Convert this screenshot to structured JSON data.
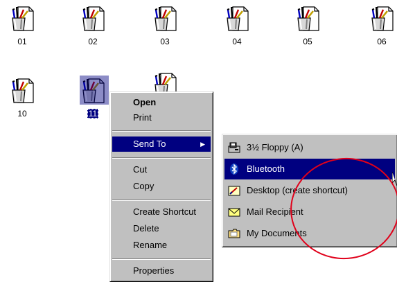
{
  "desktop": {
    "files": [
      {
        "label": "01"
      },
      {
        "label": "02"
      },
      {
        "label": "03"
      },
      {
        "label": "04"
      },
      {
        "label": "05"
      },
      {
        "label": "06"
      },
      {
        "label": "10"
      },
      {
        "label": "11",
        "selected": true
      },
      {
        "label": ""
      }
    ]
  },
  "context_menu": {
    "open": "Open",
    "print": "Print",
    "send_to": "Send To",
    "cut": "Cut",
    "copy": "Copy",
    "create_shortcut": "Create Shortcut",
    "delete": "Delete",
    "rename": "Rename",
    "properties": "Properties"
  },
  "send_to_menu": {
    "items": [
      {
        "label": "3½ Floppy (A)",
        "icon": "floppy-drive-icon"
      },
      {
        "label": "Bluetooth",
        "icon": "bluetooth-icon",
        "highlighted": true
      },
      {
        "label": "Desktop (create shortcut)",
        "icon": "desktop-shortcut-icon"
      },
      {
        "label": "Mail Recipient",
        "icon": "envelope-icon"
      },
      {
        "label": "My Documents",
        "icon": "folder-icon"
      }
    ]
  },
  "colors": {
    "menu_bg": "#c0c0c0",
    "highlight": "#000080",
    "annotation": "#e0001a"
  }
}
